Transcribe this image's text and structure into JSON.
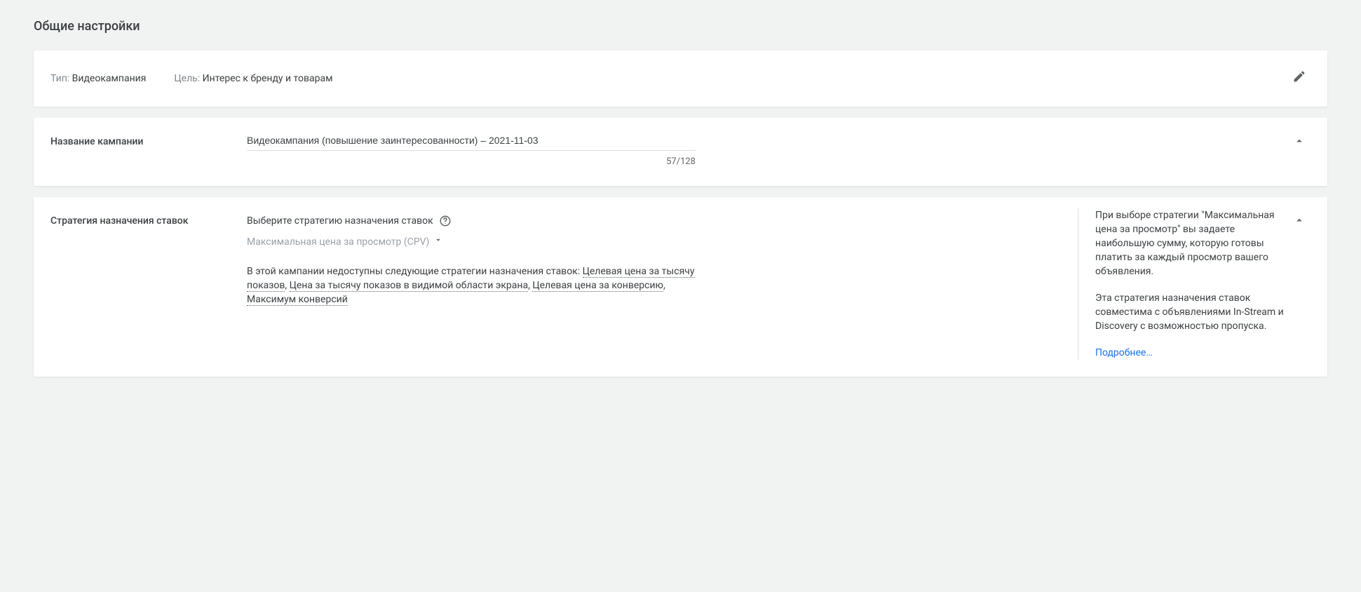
{
  "page_title": "Общие настройки",
  "type_card": {
    "type_label": "Тип:",
    "type_value": "Видеокампания",
    "goal_label": "Цель:",
    "goal_value": "Интерес к бренду и товарам"
  },
  "name_section": {
    "label": "Название кампании",
    "value": "Видеокампания (повышение заинтересованности) – 2021-11-03",
    "counter": "57/128"
  },
  "bidding_section": {
    "label": "Стратегия назначения ставок",
    "choose_label": "Выберите стратегию назначения ставок",
    "selected_value": "Максимальная цена за просмотр (CPV)",
    "unavailable_intro": "В этой кампании недоступны следующие стратегии назначения ставок:",
    "unavailable": {
      "a": "Целевая цена за тысячу показов",
      "b": "Цена за тысячу показов в видимой области экрана",
      "c": "Целевая цена за конверсию",
      "d": "Максимум конверсий"
    },
    "side": {
      "para1": "При выборе стратегии \"Максимальная цена за просмотр\" вы задаете наибольшую сумму, которую готовы платить за каждый просмотр вашего объявления.",
      "para2": "Эта стратегия назначения ставок совместима с объявлениями In-Stream и Discovery с возможностью пропуска.",
      "learn_more": "Подробнее…"
    }
  }
}
